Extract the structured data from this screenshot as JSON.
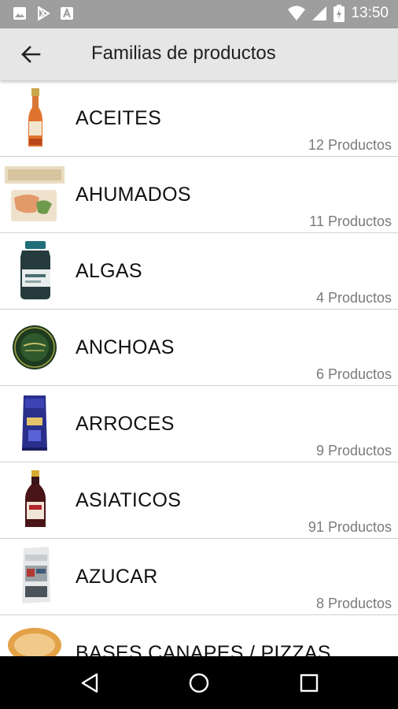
{
  "status_bar": {
    "time": "13:50",
    "icons": [
      "image-icon",
      "play-store-icon",
      "font-icon",
      "wifi-icon",
      "signal-icon",
      "battery-charging-icon"
    ]
  },
  "app_bar": {
    "back_icon": "arrow-left-icon",
    "title": "Familias de productos"
  },
  "families": [
    {
      "name": "ACEITES",
      "count": "12 Productos",
      "image": "olive-oil-bottle"
    },
    {
      "name": "AHUMADOS",
      "count": "11 Productos",
      "image": "smoked-fish-pack"
    },
    {
      "name": "ALGAS",
      "count": "4 Productos",
      "image": "seaweed-jar"
    },
    {
      "name": "ANCHOAS",
      "count": "6 Productos",
      "image": "anchovy-tin"
    },
    {
      "name": "ARROCES",
      "count": "9 Productos",
      "image": "rice-bag"
    },
    {
      "name": "ASIATICOS",
      "count": "91 Productos",
      "image": "soy-sauce-bottle"
    },
    {
      "name": "AZUCAR",
      "count": "8 Productos",
      "image": "sugar-bag"
    },
    {
      "name": "BASES CANAPES / PIZZAS",
      "count": "",
      "image": "pizza-base"
    }
  ],
  "nav_bar": {
    "icons": [
      "back-triangle-icon",
      "home-circle-icon",
      "recents-square-icon"
    ]
  },
  "colors": {
    "status_bar": "#9e9e9e",
    "app_bar": "#e6e6e6",
    "nav_bar": "#000000",
    "divider": "#d0d0d0",
    "count_text": "#7a7a7a"
  }
}
